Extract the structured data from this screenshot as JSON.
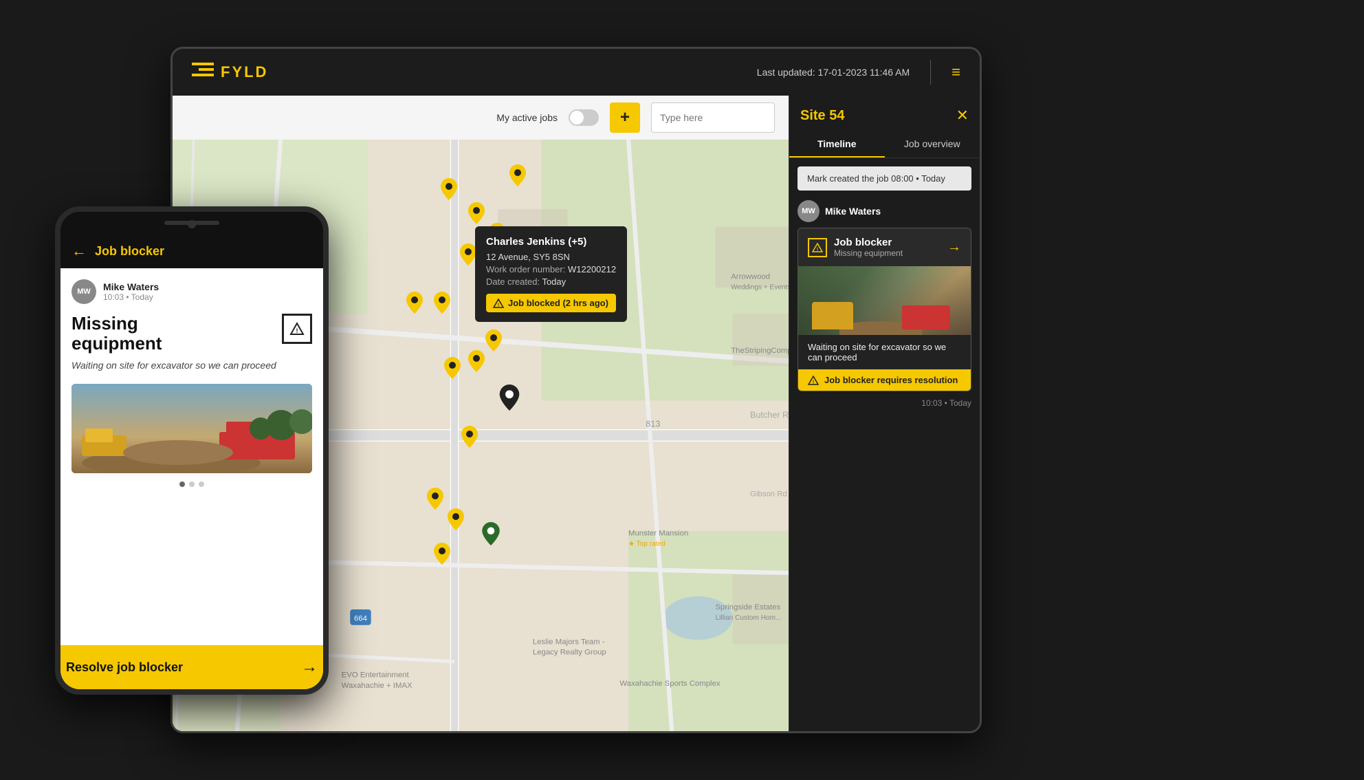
{
  "app": {
    "last_updated": "Last updated: 17-01-2023 11:46 AM",
    "logo_text": "FYLD"
  },
  "map_toolbar": {
    "my_active_jobs_label": "My active jobs",
    "search_placeholder": "Type here",
    "add_button_label": "+"
  },
  "map_popup": {
    "name": "Charles Jenkins (+5)",
    "address": "12 Avenue, SY5 8SN",
    "work_order_label": "Work order number:",
    "work_order_value": "W12200212",
    "date_label": "Date created:",
    "date_value": "Today",
    "blocked_label": "Job blocked (2 hrs ago)"
  },
  "right_panel": {
    "site_title": "Site 54",
    "tab_timeline": "Timeline",
    "tab_job_overview": "Job overview",
    "created_entry": "Mark created the job  08:00  •  Today",
    "user_name": "Mike Waters",
    "user_initials": "MW",
    "job_blocker_title": "Job blocker",
    "job_blocker_sub": "Missing equipment",
    "card_desc": "Waiting on site for excavator so we can proceed",
    "resolution_label": "Job blocker requires resolution",
    "timestamp": "10:03  •  Today"
  },
  "phone": {
    "header_title": "Job blocker",
    "user_name": "Mike Waters",
    "user_initials": "MW",
    "user_time": "10:03  •  Today",
    "missing_title_line1": "Missing",
    "missing_title_line2": "equipment",
    "description": "Waiting on site for excavator so we can proceed",
    "cta_label": "Resolve job blocker"
  },
  "icons": {
    "back_arrow": "←",
    "arrow_right": "→",
    "close": "✕",
    "hamburger": "≡",
    "plus": "+"
  }
}
